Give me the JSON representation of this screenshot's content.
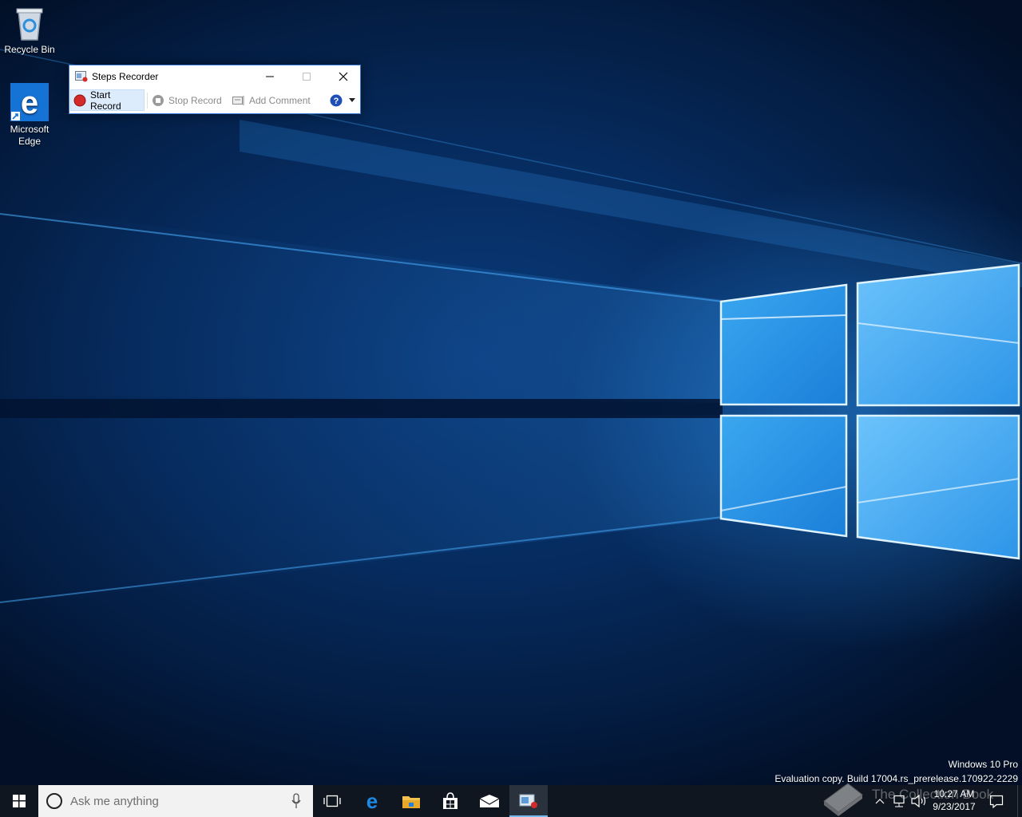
{
  "desktop": {
    "icons": [
      {
        "label": "Recycle Bin",
        "icon": "recycle-bin-icon"
      },
      {
        "label": "Microsoft Edge",
        "icon": "edge-icon"
      }
    ],
    "watermark": {
      "edition": "Windows 10 Pro",
      "build": "Evaluation copy. Build 17004.rs_prerelease.170922-2229"
    }
  },
  "steps_recorder": {
    "title": "Steps Recorder",
    "toolbar": {
      "start_label": "Start Record",
      "stop_label": "Stop Record",
      "comment_label": "Add Comment"
    },
    "colors": {
      "record_red": "#d42a2a",
      "border_accent": "#3a7bd5"
    }
  },
  "taskbar": {
    "search_placeholder": "Ask me anything",
    "pinned": [
      "windows-start-icon",
      "task-view-icon",
      "edge-icon",
      "file-explorer-icon",
      "store-icon",
      "mail-icon",
      "steps-recorder-icon"
    ],
    "clock": {
      "time": "10:27 AM",
      "date": "9/23/2017"
    },
    "watermark_text": "The Collection Book"
  }
}
